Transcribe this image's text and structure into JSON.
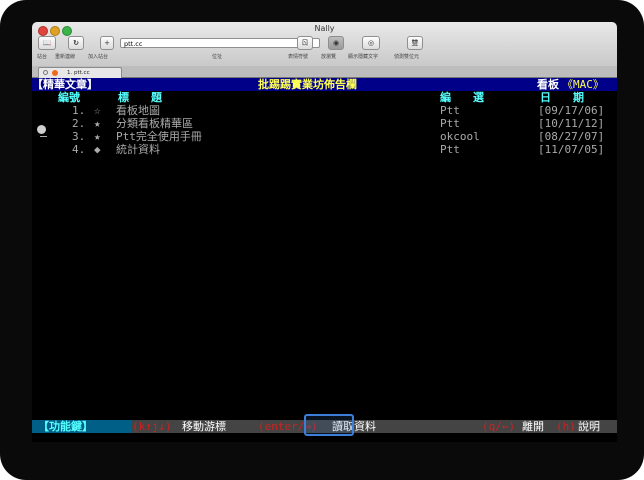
{
  "window": {
    "title": "Nally"
  },
  "toolbar": {
    "sites_label": "站台",
    "reconnect_label": "重新連線",
    "add_site_label": "加入站台",
    "address_value": "ptt.cc",
    "address_label": "位址",
    "emoticons_label": "表情符號",
    "browse_label": "放瀏覽",
    "show_hidden_label": "顯示隱藏文字",
    "detect_dbcs_label": "偵測雙位元",
    "dbcs_btn_text": "雙"
  },
  "tabs": [
    {
      "label": "1. ptt.cc"
    }
  ],
  "terminal": {
    "header": {
      "left": "【精華文章】",
      "center": "批踢踢實業坊佈告欄",
      "board_label": "看板",
      "board_name": "《MAC》"
    },
    "columns": {
      "num": "編號",
      "title": "標　　題",
      "editor": "編　　選",
      "date": "日　　期"
    },
    "rows": [
      {
        "num": "1.",
        "mark": "☆",
        "title": "看板地圖",
        "editor": "Ptt",
        "date": "[09/17/06]"
      },
      {
        "num": "2.",
        "mark": "★",
        "title": "分類看板精華區",
        "editor": "Ptt",
        "date": "[10/11/12]"
      },
      {
        "num": "3.",
        "mark": "★",
        "title": "Ptt完全使用手冊",
        "editor": "okcool",
        "date": "[08/27/07]"
      },
      {
        "num": "4.",
        "mark": "◆",
        "title": "統計資料",
        "editor": "Ptt",
        "date": "[11/07/05]"
      }
    ],
    "footer": {
      "func_label": "【功能鍵】",
      "k_hint": "(k↑j↓)",
      "move_label": "移動游標",
      "enter_hint": "(enter/→)",
      "read_label": "讀取資料",
      "quit_hint": "(q/←)",
      "quit_label": "離開",
      "help_hint": "(h)",
      "help_label": "說明"
    }
  }
}
